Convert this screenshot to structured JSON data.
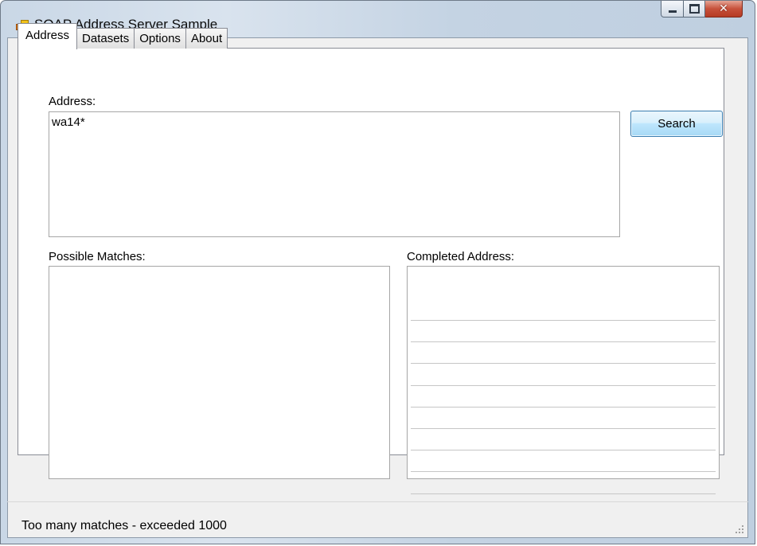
{
  "window": {
    "title": "SOAP Address Server Sample",
    "icon": "app-icon",
    "controls": [
      "minimize-icon",
      "maximize-icon",
      "close-icon"
    ]
  },
  "tabs": [
    {
      "label": "Address",
      "active": true
    },
    {
      "label": "Datasets",
      "active": false
    },
    {
      "label": "Options",
      "active": false
    },
    {
      "label": "About",
      "active": false
    }
  ],
  "address": {
    "label": "Address:",
    "value": "wa14*"
  },
  "search_button": {
    "label": "Search"
  },
  "matches": {
    "label": "Possible Matches:",
    "items": []
  },
  "completed": {
    "label": "Completed Address:",
    "lines": [
      "",
      "",
      "",
      "",
      "",
      "",
      "",
      "",
      ""
    ]
  },
  "status": {
    "text": "Too many matches - exceeded 1000"
  },
  "colors": {
    "accent": "#3c7fb1",
    "titlebar": "#c9d7e6",
    "client": "#f0f0f0"
  }
}
